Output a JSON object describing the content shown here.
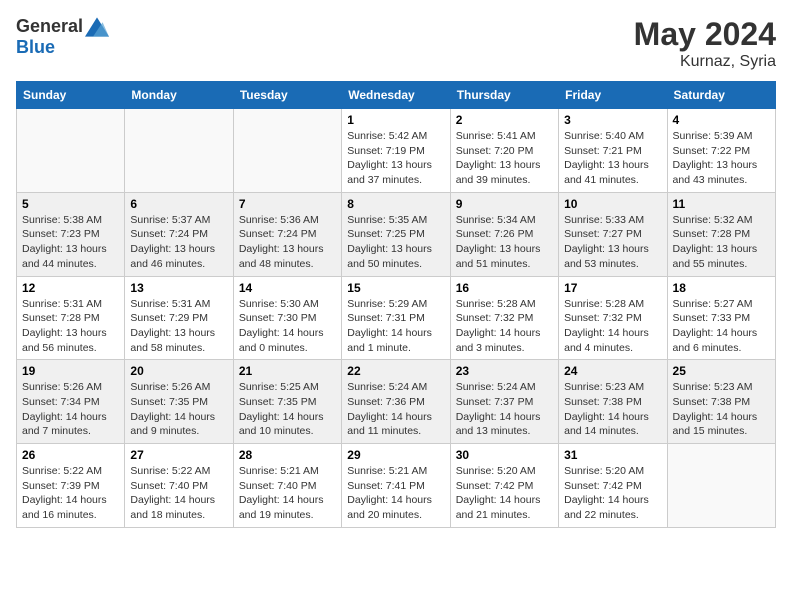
{
  "header": {
    "logo_general": "General",
    "logo_blue": "Blue",
    "month": "May 2024",
    "location": "Kurnaz, Syria"
  },
  "weekdays": [
    "Sunday",
    "Monday",
    "Tuesday",
    "Wednesday",
    "Thursday",
    "Friday",
    "Saturday"
  ],
  "weeks": [
    [
      {
        "day": null,
        "info": null
      },
      {
        "day": null,
        "info": null
      },
      {
        "day": null,
        "info": null
      },
      {
        "day": "1",
        "info": "Sunrise: 5:42 AM\nSunset: 7:19 PM\nDaylight: 13 hours\nand 37 minutes."
      },
      {
        "day": "2",
        "info": "Sunrise: 5:41 AM\nSunset: 7:20 PM\nDaylight: 13 hours\nand 39 minutes."
      },
      {
        "day": "3",
        "info": "Sunrise: 5:40 AM\nSunset: 7:21 PM\nDaylight: 13 hours\nand 41 minutes."
      },
      {
        "day": "4",
        "info": "Sunrise: 5:39 AM\nSunset: 7:22 PM\nDaylight: 13 hours\nand 43 minutes."
      }
    ],
    [
      {
        "day": "5",
        "info": "Sunrise: 5:38 AM\nSunset: 7:23 PM\nDaylight: 13 hours\nand 44 minutes."
      },
      {
        "day": "6",
        "info": "Sunrise: 5:37 AM\nSunset: 7:24 PM\nDaylight: 13 hours\nand 46 minutes."
      },
      {
        "day": "7",
        "info": "Sunrise: 5:36 AM\nSunset: 7:24 PM\nDaylight: 13 hours\nand 48 minutes."
      },
      {
        "day": "8",
        "info": "Sunrise: 5:35 AM\nSunset: 7:25 PM\nDaylight: 13 hours\nand 50 minutes."
      },
      {
        "day": "9",
        "info": "Sunrise: 5:34 AM\nSunset: 7:26 PM\nDaylight: 13 hours\nand 51 minutes."
      },
      {
        "day": "10",
        "info": "Sunrise: 5:33 AM\nSunset: 7:27 PM\nDaylight: 13 hours\nand 53 minutes."
      },
      {
        "day": "11",
        "info": "Sunrise: 5:32 AM\nSunset: 7:28 PM\nDaylight: 13 hours\nand 55 minutes."
      }
    ],
    [
      {
        "day": "12",
        "info": "Sunrise: 5:31 AM\nSunset: 7:28 PM\nDaylight: 13 hours\nand 56 minutes."
      },
      {
        "day": "13",
        "info": "Sunrise: 5:31 AM\nSunset: 7:29 PM\nDaylight: 13 hours\nand 58 minutes."
      },
      {
        "day": "14",
        "info": "Sunrise: 5:30 AM\nSunset: 7:30 PM\nDaylight: 14 hours\nand 0 minutes."
      },
      {
        "day": "15",
        "info": "Sunrise: 5:29 AM\nSunset: 7:31 PM\nDaylight: 14 hours\nand 1 minute."
      },
      {
        "day": "16",
        "info": "Sunrise: 5:28 AM\nSunset: 7:32 PM\nDaylight: 14 hours\nand 3 minutes."
      },
      {
        "day": "17",
        "info": "Sunrise: 5:28 AM\nSunset: 7:32 PM\nDaylight: 14 hours\nand 4 minutes."
      },
      {
        "day": "18",
        "info": "Sunrise: 5:27 AM\nSunset: 7:33 PM\nDaylight: 14 hours\nand 6 minutes."
      }
    ],
    [
      {
        "day": "19",
        "info": "Sunrise: 5:26 AM\nSunset: 7:34 PM\nDaylight: 14 hours\nand 7 minutes."
      },
      {
        "day": "20",
        "info": "Sunrise: 5:26 AM\nSunset: 7:35 PM\nDaylight: 14 hours\nand 9 minutes."
      },
      {
        "day": "21",
        "info": "Sunrise: 5:25 AM\nSunset: 7:35 PM\nDaylight: 14 hours\nand 10 minutes."
      },
      {
        "day": "22",
        "info": "Sunrise: 5:24 AM\nSunset: 7:36 PM\nDaylight: 14 hours\nand 11 minutes."
      },
      {
        "day": "23",
        "info": "Sunrise: 5:24 AM\nSunset: 7:37 PM\nDaylight: 14 hours\nand 13 minutes."
      },
      {
        "day": "24",
        "info": "Sunrise: 5:23 AM\nSunset: 7:38 PM\nDaylight: 14 hours\nand 14 minutes."
      },
      {
        "day": "25",
        "info": "Sunrise: 5:23 AM\nSunset: 7:38 PM\nDaylight: 14 hours\nand 15 minutes."
      }
    ],
    [
      {
        "day": "26",
        "info": "Sunrise: 5:22 AM\nSunset: 7:39 PM\nDaylight: 14 hours\nand 16 minutes."
      },
      {
        "day": "27",
        "info": "Sunrise: 5:22 AM\nSunset: 7:40 PM\nDaylight: 14 hours\nand 18 minutes."
      },
      {
        "day": "28",
        "info": "Sunrise: 5:21 AM\nSunset: 7:40 PM\nDaylight: 14 hours\nand 19 minutes."
      },
      {
        "day": "29",
        "info": "Sunrise: 5:21 AM\nSunset: 7:41 PM\nDaylight: 14 hours\nand 20 minutes."
      },
      {
        "day": "30",
        "info": "Sunrise: 5:20 AM\nSunset: 7:42 PM\nDaylight: 14 hours\nand 21 minutes."
      },
      {
        "day": "31",
        "info": "Sunrise: 5:20 AM\nSunset: 7:42 PM\nDaylight: 14 hours\nand 22 minutes."
      },
      {
        "day": null,
        "info": null
      }
    ]
  ]
}
